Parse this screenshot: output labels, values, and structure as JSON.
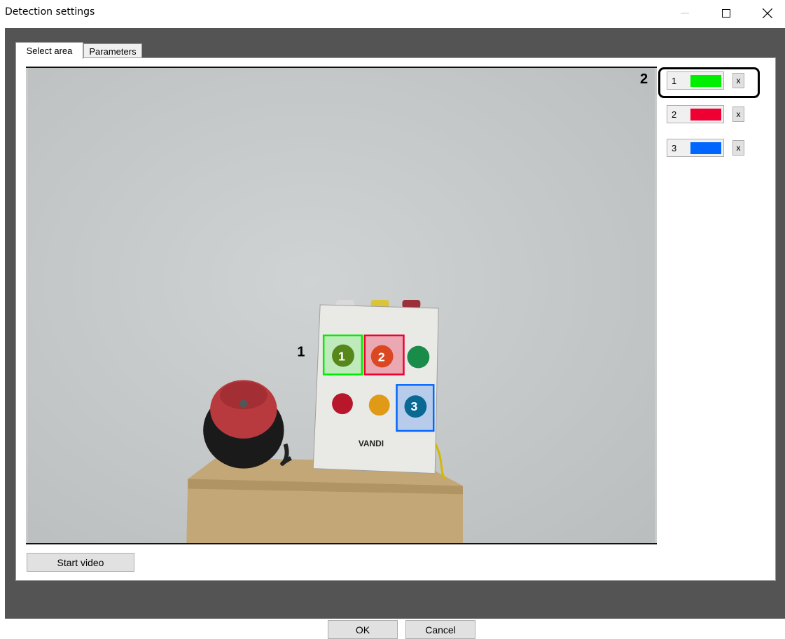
{
  "window": {
    "title": "Detection settings",
    "minimize_icon": "minimize-icon",
    "maximize_icon": "maximize-icon",
    "close_icon": "close-icon"
  },
  "tabs": [
    {
      "label": "Select area",
      "selected": true
    },
    {
      "label": "Parameters",
      "selected": false
    }
  ],
  "video": {
    "brand": "VANDI",
    "callout_1": "1",
    "zone_labels": [
      "1",
      "2",
      "3"
    ]
  },
  "callout_2": "2",
  "zones": [
    {
      "number": "1",
      "color": "#00ee00",
      "delete_label": "x"
    },
    {
      "number": "2",
      "color": "#ee0033",
      "delete_label": "x"
    },
    {
      "number": "3",
      "color": "#0066ff",
      "delete_label": "x"
    }
  ],
  "buttons": {
    "start_video": "Start video",
    "ok": "OK",
    "cancel": "Cancel"
  }
}
